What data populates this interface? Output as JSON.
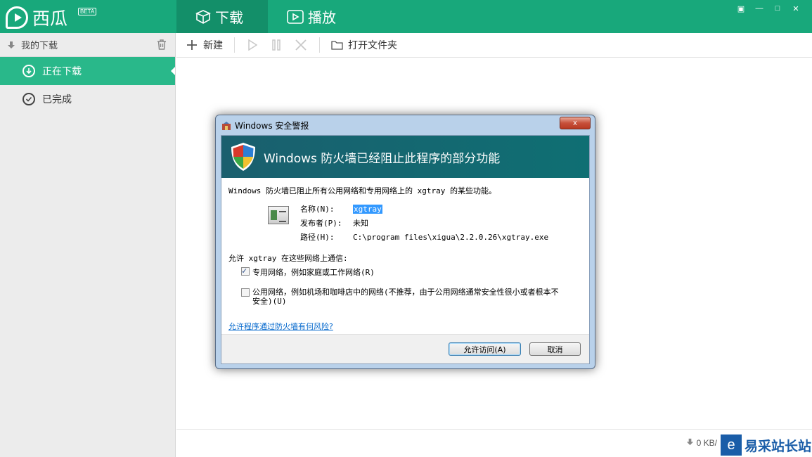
{
  "app": {
    "name": "西瓜",
    "badge": "BETA"
  },
  "tabs": [
    {
      "label": "下载",
      "active": true,
      "icon": "box-icon"
    },
    {
      "label": "播放",
      "active": false,
      "icon": "play-icon"
    }
  ],
  "window_controls": [
    "▣",
    "—",
    "□",
    "✕"
  ],
  "sidebar": {
    "header": "我的下载",
    "items": [
      {
        "label": "正在下载",
        "active": true
      },
      {
        "label": "已完成",
        "active": false
      }
    ]
  },
  "toolbar": {
    "new_label": "新建",
    "open_folder_label": "打开文件夹"
  },
  "status": {
    "speed": "0 KB/"
  },
  "watermark": {
    "logo_char": "e",
    "text": "易采站长站"
  },
  "dialog": {
    "title": "Windows 安全警报",
    "banner": "Windows 防火墙已经阻止此程序的部分功能",
    "description": "Windows 防火墙已阻止所有公用网络和专用网络上的 xgtray 的某些功能。",
    "name_label": "名称(N):",
    "name_value": "xgtray",
    "publisher_label": "发布者(P):",
    "publisher_value": "未知",
    "path_label": "路径(H):",
    "path_value": "C:\\program files\\xigua\\2.2.0.26\\xgtray.exe",
    "allow_text": "允许 xgtray 在这些网络上通信:",
    "private_option": "专用网络，例如家庭或工作网络(R)",
    "private_checked": true,
    "public_option": "公用网络，例如机场和咖啡店中的网络(不推荐，由于公用网络通常安全性很小或者根本不安全)(U)",
    "public_checked": false,
    "risk_link": "允许程序通过防火墙有何风险?",
    "allow_button": "允许访问(A)",
    "cancel_button": "取消",
    "close_glyph": "x"
  }
}
